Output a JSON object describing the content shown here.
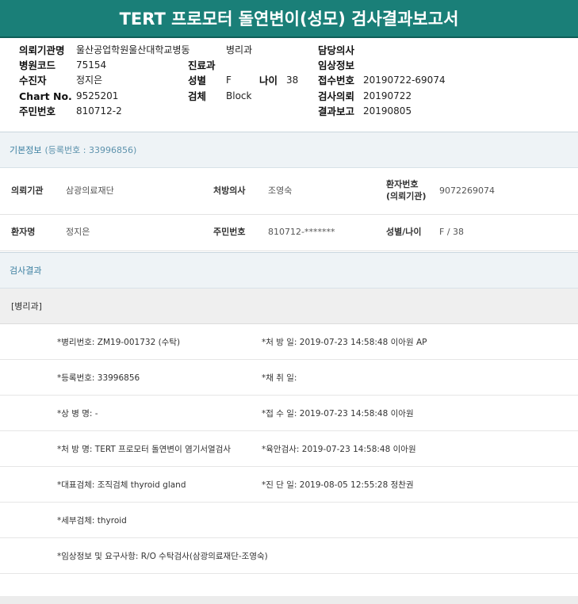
{
  "title": "TERT 프로모터 돌연변이(성모) 검사결과보고서",
  "header": {
    "institution_label": "의뢰기관명",
    "institution_value": "울산공업학원울산대학교병동",
    "institution_dept": "병리과",
    "doctor_label": "담당의사",
    "hospital_code_label": "병원코드",
    "hospital_code_value": "75154",
    "department_label": "진료과",
    "clinical_info_label": "임상정보",
    "patient_label": "수진자",
    "patient_value": "정지은",
    "sex_label": "성별",
    "sex_value": "F",
    "age_label": "나이",
    "age_value": "38",
    "receipt_label": "접수번호",
    "receipt_value": "20190722-69074",
    "chart_label": "Chart No.",
    "chart_value": "9525201",
    "specimen_label": "검체",
    "specimen_value": "Block",
    "request_date_label": "검사의뢰",
    "request_date_value": "20190722",
    "resident_label": "주민번호",
    "resident_value": "810712-2",
    "report_label": "결과보고",
    "report_value": "20190805"
  },
  "basic_info": {
    "heading": "기본정보",
    "reg_note": "(등록번호 : 33996856)",
    "row1": {
      "inst_label": "의뢰기관",
      "inst_value": "삼광의료재단",
      "rx_doctor_label": "처방의사",
      "rx_doctor_value": "조영숙",
      "patient_no_label_1": "환자번호",
      "patient_no_label_2": "(의뢰기관)",
      "patient_no_value": "9072269074"
    },
    "row2": {
      "name_label": "환자명",
      "name_value": "정지은",
      "resident_label": "주민번호",
      "resident_value": "810712-*******",
      "sexage_label": "성별/나이",
      "sexage_value": "F / 38"
    }
  },
  "results": {
    "heading": "검사결과",
    "dept": "[병리과]",
    "rows": [
      {
        "left": "*병리번호: ZM19-001732 (수탁)",
        "right": "*처 방 일: 2019-07-23 14:58:48  이아원 AP"
      },
      {
        "left": "*등록번호: 33996856",
        "right": "*채 취 일:"
      },
      {
        "left": "*상 병 명: -",
        "right": "*접 수 일: 2019-07-23 14:58:48  이아원"
      },
      {
        "left": "*처 방 명: TERT 프로모터 돌연변이 염기서열검사",
        "right": "*육안검사: 2019-07-23 14:58:48  이아원"
      },
      {
        "left": "*대표검체: 조직검체 thyroid gland",
        "right": "*진 단 일: 2019-08-05 12:55:28  정찬권"
      },
      {
        "left": "*세부검체: thyroid",
        "right": ""
      },
      {
        "left": "*임상정보 및 요구사항: R/O 수탁검사(삼광의료재단-조영숙)",
        "right": ""
      }
    ]
  }
}
